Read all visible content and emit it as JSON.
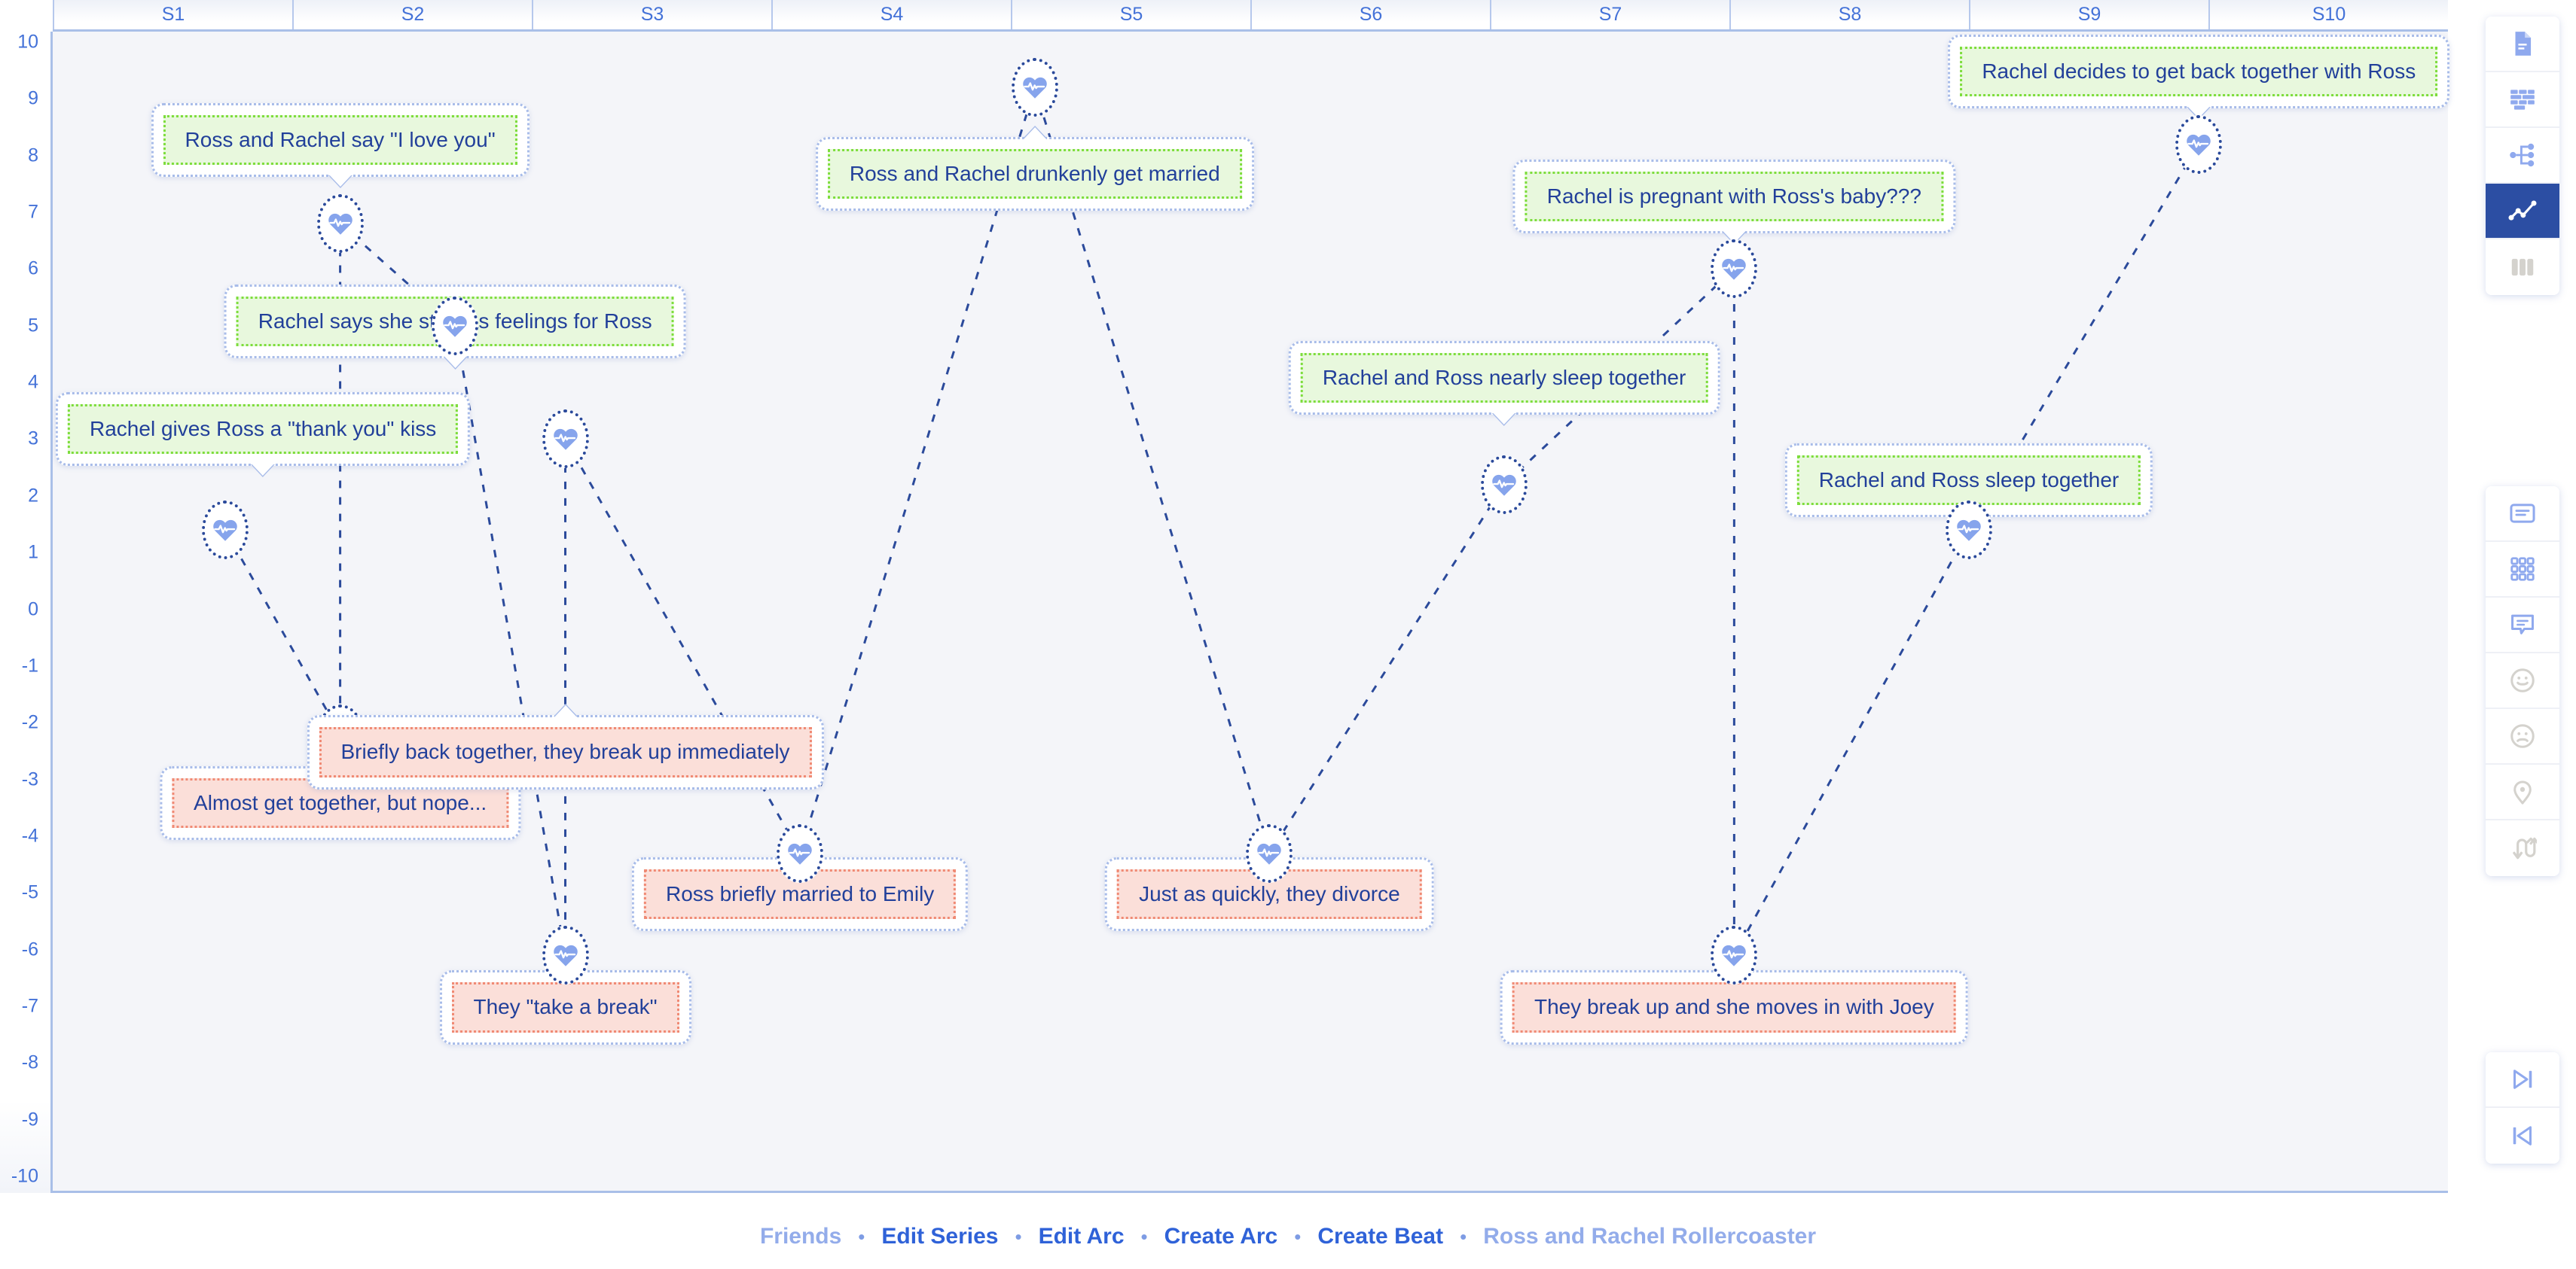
{
  "chart_data": {
    "type": "scatter",
    "title": "Ross and Rachel Rollercoaster",
    "xlabel": "",
    "ylabel": "",
    "grid": false,
    "legend": "none",
    "ylim": [
      -10,
      10
    ],
    "x_categories": [
      "S1",
      "S2",
      "S3",
      "S4",
      "S5",
      "S6",
      "S7",
      "S8",
      "S9",
      "S10"
    ],
    "y_ticks": [
      "10",
      "9",
      "8",
      "7",
      "6",
      "5",
      "4",
      "3",
      "2",
      "1",
      "0",
      "-1",
      "-2",
      "-3",
      "-4",
      "-5",
      "-6",
      "-7",
      "-8",
      "-9",
      "-10"
    ],
    "series": [
      {
        "name": "Ross and Rachel Rollercoaster",
        "points": [
          {
            "label": "Rachel gives Ross a \"thank you\" kiss",
            "season": "S1",
            "x": 0.22,
            "y": 1.4,
            "sentiment": "positive",
            "card_y": 3.1
          },
          {
            "label": "Almost get together, but nope...",
            "season": "S2",
            "x": 0.7,
            "y": -2.2,
            "sentiment": "negative",
            "card_y": -3.5
          },
          {
            "label": "Ross and Rachel say \"I love you\"",
            "season": "S2",
            "x": 0.7,
            "y": 6.8,
            "sentiment": "positive",
            "card_y": 8.2
          },
          {
            "label": "Rachel says she still has feelings for Ross",
            "season": "S2",
            "x": 1.18,
            "y": 5.0,
            "sentiment": "positive",
            "card_y": 5.0
          },
          {
            "label": "They \"take a break\"",
            "season": "S3",
            "x": 1.64,
            "y": -6.1,
            "sentiment": "negative",
            "card_y": -7.1
          },
          {
            "label": "Briefly back together, they break up immediately",
            "season": "S3",
            "x": 1.64,
            "y": 3.0,
            "sentiment": "negative",
            "card_y": -2.6
          },
          {
            "label": "Ross briefly married to Emily",
            "season": "S4",
            "x": 2.62,
            "y": -4.3,
            "sentiment": "negative",
            "card_y": -5.1
          },
          {
            "label": "Ross and Rachel drunkenly get married",
            "season": "S5",
            "x": 3.6,
            "y": 9.2,
            "sentiment": "positive",
            "card_y": 7.6
          },
          {
            "label": "Just as quickly, they divorce",
            "season": "S6",
            "x": 4.58,
            "y": -4.3,
            "sentiment": "negative",
            "card_y": -5.1
          },
          {
            "label": "Rachel and Ross nearly sleep together",
            "season": "S7",
            "x": 5.56,
            "y": 2.2,
            "sentiment": "positive",
            "card_y": 4.0
          },
          {
            "label": "Rachel is pregnant with Ross's baby???",
            "season": "S8",
            "x": 6.52,
            "y": 6.0,
            "sentiment": "positive",
            "card_y": 7.2
          },
          {
            "label": "They break up and she moves in with Joey",
            "season": "S8",
            "x": 6.52,
            "y": -6.1,
            "sentiment": "negative",
            "card_y": -7.1
          },
          {
            "label": "Rachel and Ross sleep together",
            "season": "S9",
            "x": 7.5,
            "y": 1.4,
            "sentiment": "positive",
            "card_y": 2.2
          },
          {
            "label": "Rachel decides to get back together with Ross",
            "season": "S10",
            "x": 8.46,
            "y": 8.2,
            "sentiment": "positive",
            "card_y": 9.4
          }
        ]
      }
    ]
  },
  "toolbars": {
    "top": [
      {
        "name": "document-icon",
        "label": "Document",
        "active": false,
        "disabled": false
      },
      {
        "name": "wall-icon",
        "label": "Wall",
        "active": false,
        "disabled": false
      },
      {
        "name": "sitemap-icon",
        "label": "Sitemap",
        "active": false,
        "disabled": false
      },
      {
        "name": "line-chart-icon",
        "label": "Arc Chart",
        "active": true,
        "disabled": false
      },
      {
        "name": "columns-icon",
        "label": "Columns",
        "active": false,
        "disabled": true
      }
    ],
    "middle": [
      {
        "name": "text-card-icon",
        "label": "Text Card",
        "active": false,
        "disabled": false
      },
      {
        "name": "grid-icon",
        "label": "Grid",
        "active": false,
        "disabled": false
      },
      {
        "name": "comment-icon",
        "label": "Comment",
        "active": false,
        "disabled": false
      },
      {
        "name": "happy-face-icon",
        "label": "Positive",
        "active": false,
        "disabled": true
      },
      {
        "name": "sad-face-icon",
        "label": "Negative",
        "active": false,
        "disabled": true
      },
      {
        "name": "map-pin-icon",
        "label": "Location",
        "active": false,
        "disabled": true
      },
      {
        "name": "shuffle-icon",
        "label": "Reorder",
        "active": false,
        "disabled": true
      }
    ],
    "bottom": [
      {
        "name": "skip-forward-icon",
        "label": "Skip Forward",
        "active": false,
        "disabled": false
      },
      {
        "name": "skip-backward-icon",
        "label": "Skip Backward",
        "active": false,
        "disabled": false
      }
    ]
  },
  "footer": {
    "items": [
      {
        "label": "Friends",
        "muted": true
      },
      {
        "label": "Edit Series",
        "muted": false
      },
      {
        "label": "Edit Arc",
        "muted": false
      },
      {
        "label": "Create Arc",
        "muted": false
      },
      {
        "label": "Create Beat",
        "muted": false
      },
      {
        "label": "Ross and Rachel Rollercoaster",
        "muted": true
      }
    ],
    "separator": "•"
  },
  "colors": {
    "accent": "#2f62d8",
    "accent_muted": "#93acea",
    "axis": "#4472d8",
    "plot_bg": "#f4f5f9",
    "positive_bg": "#e8f8dd",
    "positive_border": "#7ddd3c",
    "negative_bg": "#fbdfd9",
    "negative_border": "#f08a74",
    "card_border": "#a8bce9",
    "node_ring": "#2b4a9b",
    "heart": "#86a4ec",
    "toolbar_active": "#2c4ea3",
    "toolbar_icon": "#8fa9ee",
    "toolbar_icon_disabled": "#d4d2cd"
  }
}
